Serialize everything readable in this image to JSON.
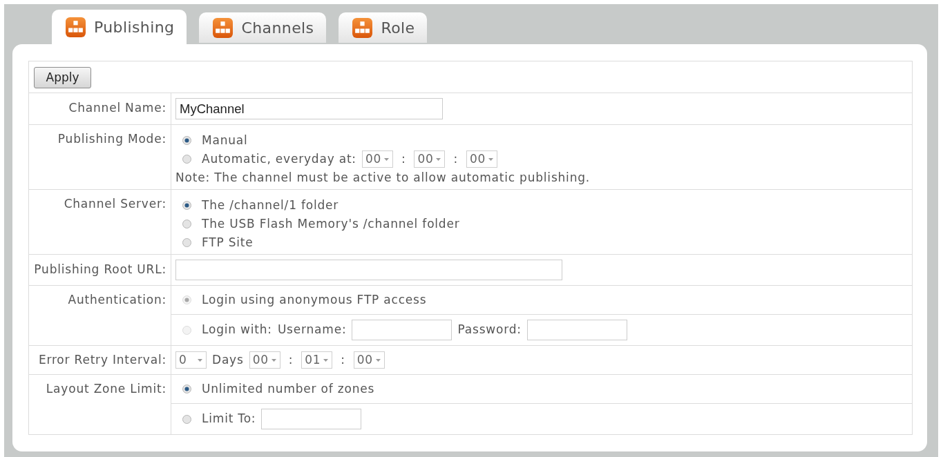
{
  "tabs": [
    {
      "label": "Publishing",
      "selected": true
    },
    {
      "label": "Channels",
      "selected": false
    },
    {
      "label": "Role",
      "selected": false
    }
  ],
  "apply_button": "Apply",
  "rows": [
    {
      "label": "Channel Name:",
      "blocks": [
        [
          [
            {
              "kind": "input",
              "value": "MyChannel"
            }
          ]
        ]
      ]
    },
    {
      "label": "Publishing Mode:",
      "blocks": [
        [
          [
            {
              "kind": "radio",
              "label": "Manual",
              "selected": true,
              "disabled": false
            }
          ],
          [
            {
              "kind": "radio",
              "label": "Automatic, everyday at:",
              "selected": false,
              "disabled": false
            },
            {
              "kind": "select",
              "value": "00"
            },
            {
              "kind": "separator",
              "text": ":"
            },
            {
              "kind": "select",
              "value": "00"
            },
            {
              "kind": "separator",
              "text": ":"
            },
            {
              "kind": "select",
              "value": "00"
            }
          ],
          [
            {
              "kind": "note",
              "text": "Note: The channel must be active to allow automatic publishing."
            }
          ]
        ]
      ]
    },
    {
      "label": "Channel Server:",
      "blocks": [
        [
          [
            {
              "kind": "radio",
              "label": "The /channel/1 folder",
              "selected": true,
              "disabled": false
            }
          ],
          [
            {
              "kind": "radio",
              "label": "The USB Flash Memory's /channel folder",
              "selected": false,
              "disabled": false
            }
          ],
          [
            {
              "kind": "radio",
              "label": "FTP Site",
              "selected": false,
              "disabled": false
            }
          ]
        ]
      ]
    },
    {
      "label": "Publishing Root URL:",
      "blocks": [
        [
          [
            {
              "kind": "input"
            }
          ]
        ]
      ]
    },
    {
      "label": "Authentication:",
      "blocks": [
        [
          [
            {
              "kind": "radio",
              "label": "Login using anonymous FTP access",
              "selected": true,
              "disabled": true
            }
          ]
        ],
        [
          [
            {
              "kind": "radio",
              "label": "Login with:",
              "selected": false,
              "disabled": true
            },
            {
              "kind": "label",
              "text": "Username:"
            },
            {
              "kind": "input"
            },
            {
              "kind": "label",
              "text": "Password:"
            },
            {
              "kind": "input"
            }
          ]
        ]
      ]
    },
    {
      "label": "Error Retry Interval:",
      "blocks": [
        [
          [
            {
              "kind": "select",
              "value": "0"
            },
            {
              "kind": "label",
              "text": "Days"
            },
            {
              "kind": "select",
              "value": "00"
            },
            {
              "kind": "separator",
              "text": ":"
            },
            {
              "kind": "select",
              "value": "01"
            },
            {
              "kind": "separator",
              "text": ":"
            },
            {
              "kind": "select",
              "value": "00"
            }
          ]
        ]
      ]
    },
    {
      "label": "Layout Zone Limit:",
      "blocks": [
        [
          [
            {
              "kind": "radio",
              "label": "Unlimited number of zones",
              "selected": true,
              "disabled": false
            }
          ]
        ],
        [
          [
            {
              "kind": "radio",
              "label": "Limit To:",
              "selected": false,
              "disabled": false
            },
            {
              "kind": "input"
            }
          ]
        ]
      ]
    }
  ]
}
